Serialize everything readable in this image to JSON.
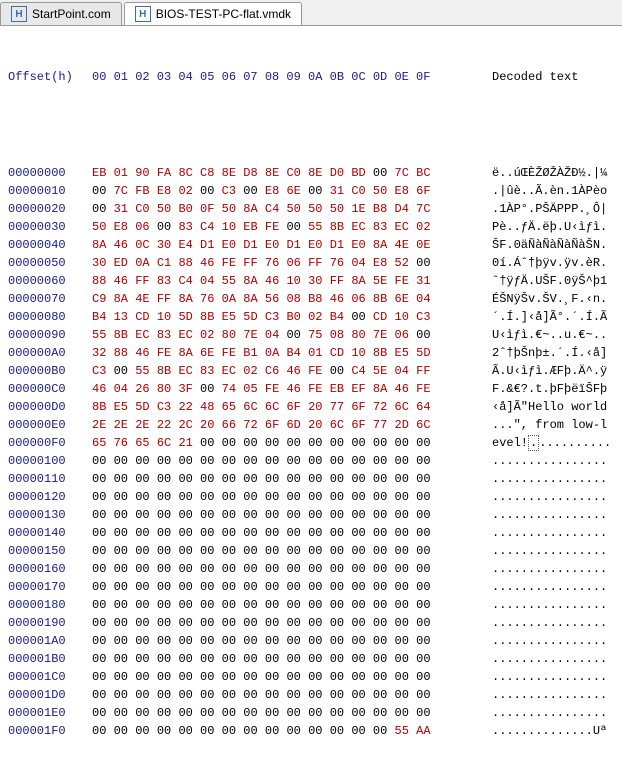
{
  "tabs": [
    {
      "label": "StartPoint.com",
      "active": false
    },
    {
      "label": "BIOS-TEST-PC-flat.vmdk",
      "active": true
    }
  ],
  "header": {
    "offset": "Offset(h)",
    "cols": "00 01 02 03 04 05 06 07 08 09 0A 0B 0C 0D 0E 0F",
    "dec": "Decoded text"
  },
  "rows": [
    {
      "o": "00000000",
      "b": [
        "EB",
        "01",
        "90",
        "FA",
        "8C",
        "C8",
        "8E",
        "D8",
        "8E",
        "C0",
        "8E",
        "D0",
        "BD",
        "00",
        "7C",
        "BC"
      ],
      "d": "ë..úŒÈŽØŽÀŽĐ½.|¼"
    },
    {
      "o": "00000010",
      "b": [
        "00",
        "7C",
        "FB",
        "E8",
        "02",
        "00",
        "C3",
        "00",
        "E8",
        "6E",
        "00",
        "31",
        "C0",
        "50",
        "E8",
        "6F"
      ],
      "d": ".|ûè..Ã.èn.1ÀPèo"
    },
    {
      "o": "00000020",
      "b": [
        "00",
        "31",
        "C0",
        "50",
        "B0",
        "0F",
        "50",
        "8A",
        "C4",
        "50",
        "50",
        "50",
        "1E",
        "B8",
        "D4",
        "7C"
      ],
      "d": ".1ÀP°.PŠÄPPP.¸Ô|"
    },
    {
      "o": "00000030",
      "b": [
        "50",
        "E8",
        "06",
        "00",
        "83",
        "C4",
        "10",
        "EB",
        "FE",
        "00",
        "55",
        "8B",
        "EC",
        "83",
        "EC",
        "02"
      ],
      "d": "Pè..ƒÄ.ëþ.U‹ìƒì."
    },
    {
      "o": "00000040",
      "b": [
        "8A",
        "46",
        "0C",
        "30",
        "E4",
        "D1",
        "E0",
        "D1",
        "E0",
        "D1",
        "E0",
        "D1",
        "E0",
        "8A",
        "4E",
        "0E"
      ],
      "d": "ŠF.0äÑàÑàÑàÑàŠN."
    },
    {
      "o": "00000050",
      "b": [
        "30",
        "ED",
        "0A",
        "C1",
        "88",
        "46",
        "FE",
        "FF",
        "76",
        "06",
        "FF",
        "76",
        "04",
        "E8",
        "52",
        "00"
      ],
      "d": "0í.Áˆ†þÿv.ÿv.èR."
    },
    {
      "o": "00000060",
      "b": [
        "88",
        "46",
        "FF",
        "83",
        "C4",
        "04",
        "55",
        "8A",
        "46",
        "10",
        "30",
        "FF",
        "8A",
        "5E",
        "FE",
        "31"
      ],
      "d": "ˆ†ÿƒÄ.UŠF.0ÿŠ^þ1"
    },
    {
      "o": "00000070",
      "b": [
        "C9",
        "8A",
        "4E",
        "FF",
        "8A",
        "76",
        "0A",
        "8A",
        "56",
        "08",
        "B8",
        "46",
        "06",
        "8B",
        "6E",
        "04"
      ],
      "d": "ÉŠNÿŠv.ŠV.¸F.‹n."
    },
    {
      "o": "00000080",
      "b": [
        "B4",
        "13",
        "CD",
        "10",
        "5D",
        "8B",
        "E5",
        "5D",
        "C3",
        "B0",
        "02",
        "B4",
        "00",
        "CD",
        "10",
        "C3"
      ],
      "d": "´.Í.]‹å]Ã°.´.Í.Ã"
    },
    {
      "o": "00000090",
      "b": [
        "55",
        "8B",
        "EC",
        "83",
        "EC",
        "02",
        "80",
        "7E",
        "04",
        "00",
        "75",
        "08",
        "80",
        "7E",
        "06",
        "00"
      ],
      "d": "U‹ìƒì.€~..u.€~.."
    },
    {
      "o": "000000A0",
      "b": [
        "32",
        "88",
        "46",
        "FE",
        "8A",
        "6E",
        "FE",
        "B1",
        "0A",
        "B4",
        "01",
        "CD",
        "10",
        "8B",
        "E5",
        "5D"
      ],
      "d": "2ˆ†þŠnþ±.´.Í.‹å]"
    },
    {
      "o": "000000B0",
      "b": [
        "C3",
        "00",
        "55",
        "8B",
        "EC",
        "83",
        "EC",
        "02",
        "C6",
        "46",
        "FE",
        "00",
        "C4",
        "5E",
        "04",
        "FF"
      ],
      "d": "Ã.U‹ìƒì.ÆFþ.Ä^.ÿ"
    },
    {
      "o": "000000C0",
      "b": [
        "46",
        "04",
        "26",
        "80",
        "3F",
        "00",
        "74",
        "05",
        "FE",
        "46",
        "FE",
        "EB",
        "EF",
        "8A",
        "46",
        "FE"
      ],
      "d": "F.&€?.t.þFþëïŠFþ"
    },
    {
      "o": "000000D0",
      "b": [
        "8B",
        "E5",
        "5D",
        "C3",
        "22",
        "48",
        "65",
        "6C",
        "6C",
        "6F",
        "20",
        "77",
        "6F",
        "72",
        "6C",
        "64"
      ],
      "d": "‹å]Ã\"Hello world"
    },
    {
      "o": "000000E0",
      "b": [
        "2E",
        "2E",
        "2E",
        "22",
        "2C",
        "20",
        "66",
        "72",
        "6F",
        "6D",
        "20",
        "6C",
        "6F",
        "77",
        "2D",
        "6C"
      ],
      "d": "...\", from low-l"
    },
    {
      "o": "000000F0",
      "b": [
        "65",
        "76",
        "65",
        "6C",
        "21",
        "00",
        "00",
        "00",
        "00",
        "00",
        "00",
        "00",
        "00",
        "00",
        "00",
        "00"
      ],
      "d": "evel!..........."
    },
    {
      "o": "00000100",
      "b": [
        "00",
        "00",
        "00",
        "00",
        "00",
        "00",
        "00",
        "00",
        "00",
        "00",
        "00",
        "00",
        "00",
        "00",
        "00",
        "00"
      ],
      "d": "................"
    },
    {
      "o": "00000110",
      "b": [
        "00",
        "00",
        "00",
        "00",
        "00",
        "00",
        "00",
        "00",
        "00",
        "00",
        "00",
        "00",
        "00",
        "00",
        "00",
        "00"
      ],
      "d": "................"
    },
    {
      "o": "00000120",
      "b": [
        "00",
        "00",
        "00",
        "00",
        "00",
        "00",
        "00",
        "00",
        "00",
        "00",
        "00",
        "00",
        "00",
        "00",
        "00",
        "00"
      ],
      "d": "................"
    },
    {
      "o": "00000130",
      "b": [
        "00",
        "00",
        "00",
        "00",
        "00",
        "00",
        "00",
        "00",
        "00",
        "00",
        "00",
        "00",
        "00",
        "00",
        "00",
        "00"
      ],
      "d": "................"
    },
    {
      "o": "00000140",
      "b": [
        "00",
        "00",
        "00",
        "00",
        "00",
        "00",
        "00",
        "00",
        "00",
        "00",
        "00",
        "00",
        "00",
        "00",
        "00",
        "00"
      ],
      "d": "................"
    },
    {
      "o": "00000150",
      "b": [
        "00",
        "00",
        "00",
        "00",
        "00",
        "00",
        "00",
        "00",
        "00",
        "00",
        "00",
        "00",
        "00",
        "00",
        "00",
        "00"
      ],
      "d": "................"
    },
    {
      "o": "00000160",
      "b": [
        "00",
        "00",
        "00",
        "00",
        "00",
        "00",
        "00",
        "00",
        "00",
        "00",
        "00",
        "00",
        "00",
        "00",
        "00",
        "00"
      ],
      "d": "................"
    },
    {
      "o": "00000170",
      "b": [
        "00",
        "00",
        "00",
        "00",
        "00",
        "00",
        "00",
        "00",
        "00",
        "00",
        "00",
        "00",
        "00",
        "00",
        "00",
        "00"
      ],
      "d": "................"
    },
    {
      "o": "00000180",
      "b": [
        "00",
        "00",
        "00",
        "00",
        "00",
        "00",
        "00",
        "00",
        "00",
        "00",
        "00",
        "00",
        "00",
        "00",
        "00",
        "00"
      ],
      "d": "................"
    },
    {
      "o": "00000190",
      "b": [
        "00",
        "00",
        "00",
        "00",
        "00",
        "00",
        "00",
        "00",
        "00",
        "00",
        "00",
        "00",
        "00",
        "00",
        "00",
        "00"
      ],
      "d": "................"
    },
    {
      "o": "000001A0",
      "b": [
        "00",
        "00",
        "00",
        "00",
        "00",
        "00",
        "00",
        "00",
        "00",
        "00",
        "00",
        "00",
        "00",
        "00",
        "00",
        "00"
      ],
      "d": "................"
    },
    {
      "o": "000001B0",
      "b": [
        "00",
        "00",
        "00",
        "00",
        "00",
        "00",
        "00",
        "00",
        "00",
        "00",
        "00",
        "00",
        "00",
        "00",
        "00",
        "00"
      ],
      "d": "................"
    },
    {
      "o": "000001C0",
      "b": [
        "00",
        "00",
        "00",
        "00",
        "00",
        "00",
        "00",
        "00",
        "00",
        "00",
        "00",
        "00",
        "00",
        "00",
        "00",
        "00"
      ],
      "d": "................"
    },
    {
      "o": "000001D0",
      "b": [
        "00",
        "00",
        "00",
        "00",
        "00",
        "00",
        "00",
        "00",
        "00",
        "00",
        "00",
        "00",
        "00",
        "00",
        "00",
        "00"
      ],
      "d": "................"
    },
    {
      "o": "000001E0",
      "b": [
        "00",
        "00",
        "00",
        "00",
        "00",
        "00",
        "00",
        "00",
        "00",
        "00",
        "00",
        "00",
        "00",
        "00",
        "00",
        "00"
      ],
      "d": "................"
    },
    {
      "o": "000001F0",
      "b": [
        "00",
        "00",
        "00",
        "00",
        "00",
        "00",
        "00",
        "00",
        "00",
        "00",
        "00",
        "00",
        "00",
        "00",
        "55",
        "AA"
      ],
      "d": "..............Uª"
    }
  ]
}
